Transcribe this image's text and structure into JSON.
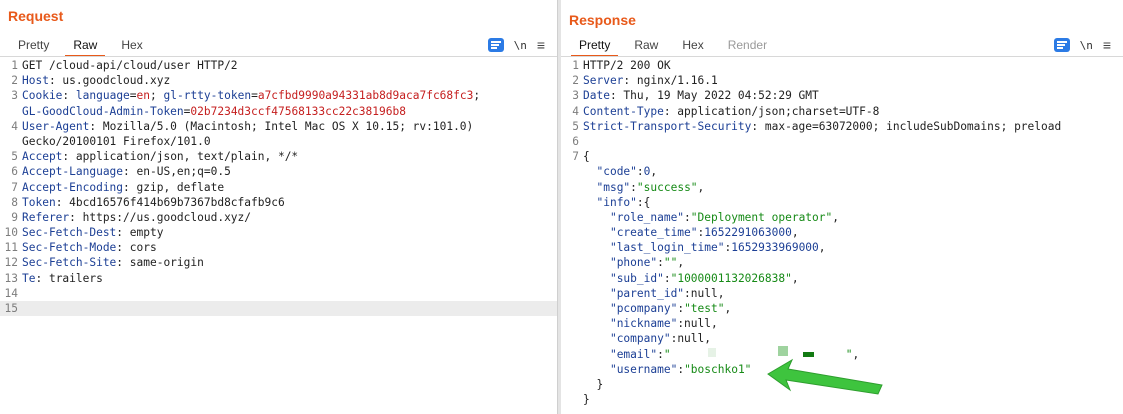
{
  "request": {
    "title": "Request",
    "tabs": [
      "Pretty",
      "Raw",
      "Hex"
    ],
    "active_tab": "Raw",
    "lines": [
      [
        {
          "t": "GET /cloud-api/cloud/user HTTP/2",
          "c": "plain"
        }
      ],
      [
        {
          "t": "Host",
          "c": "hname"
        },
        {
          "t": ": us.goodcloud.xyz",
          "c": "hval"
        }
      ],
      [
        {
          "t": "Cookie",
          "c": "hname"
        },
        {
          "t": ": ",
          "c": "hval"
        },
        {
          "t": "language",
          "c": "hname"
        },
        {
          "t": "=",
          "c": "hval"
        },
        {
          "t": "en",
          "c": "ck"
        },
        {
          "t": "; ",
          "c": "hval"
        },
        {
          "t": "gl-rtty-token",
          "c": "hname"
        },
        {
          "t": "=",
          "c": "hval"
        },
        {
          "t": "a7cfbd9990a94331ab8d9aca7fc68fc3",
          "c": "ck"
        },
        {
          "t": ";",
          "c": "hval"
        }
      ],
      [
        {
          "t": "GL-GoodCloud-Admin-Token",
          "c": "hname"
        },
        {
          "t": "=",
          "c": "hval"
        },
        {
          "t": "02b7234d3ccf47568133cc22c38196b8",
          "c": "ck"
        }
      ],
      [
        {
          "t": "User-Agent",
          "c": "hname"
        },
        {
          "t": ": Mozilla/5.0 (Macintosh; Intel Mac OS X 10.15; rv:101.0)",
          "c": "hval"
        }
      ],
      [
        {
          "t": "Gecko/20100101 Firefox/101.0",
          "c": "hval"
        }
      ],
      [
        {
          "t": "Accept",
          "c": "hname"
        },
        {
          "t": ": application/json, text/plain, */*",
          "c": "hval"
        }
      ],
      [
        {
          "t": "Accept-Language",
          "c": "hname"
        },
        {
          "t": ": en-US,en;q=0.5",
          "c": "hval"
        }
      ],
      [
        {
          "t": "Accept-Encoding",
          "c": "hname"
        },
        {
          "t": ": gzip, deflate",
          "c": "hval"
        }
      ],
      [
        {
          "t": "Token",
          "c": "hname"
        },
        {
          "t": ": 4bcd16576f414b69b7367bd8cfafb9c6",
          "c": "hval"
        }
      ],
      [
        {
          "t": "Referer",
          "c": "hname"
        },
        {
          "t": ": https://us.goodcloud.xyz/",
          "c": "hval"
        }
      ],
      [
        {
          "t": "Sec-Fetch-Dest",
          "c": "hname"
        },
        {
          "t": ": empty",
          "c": "hval"
        }
      ],
      [
        {
          "t": "Sec-Fetch-Mode",
          "c": "hname"
        },
        {
          "t": ": cors",
          "c": "hval"
        }
      ],
      [
        {
          "t": "Sec-Fetch-Site",
          "c": "hname"
        },
        {
          "t": ": same-origin",
          "c": "hval"
        }
      ],
      [
        {
          "t": "Te",
          "c": "hname"
        },
        {
          "t": ": trailers",
          "c": "hval"
        }
      ],
      [],
      []
    ],
    "line_numbers": [
      "1",
      "2",
      "3",
      "",
      "4",
      "",
      "5",
      "6",
      "7",
      "8",
      "9",
      "10",
      "11",
      "12",
      "13",
      "14",
      "15"
    ]
  },
  "response": {
    "title": "Response",
    "tabs": [
      "Pretty",
      "Raw",
      "Hex",
      "Render"
    ],
    "active_tab": "Pretty",
    "lines": [
      [
        {
          "t": "HTTP/2 200 OK",
          "c": "plain"
        }
      ],
      [
        {
          "t": "Server",
          "c": "hname"
        },
        {
          "t": ": nginx/1.16.1",
          "c": "hval"
        }
      ],
      [
        {
          "t": "Date",
          "c": "hname"
        },
        {
          "t": ": Thu, 19 May 2022 04:52:29 GMT",
          "c": "hval"
        }
      ],
      [
        {
          "t": "Content-Type",
          "c": "hname"
        },
        {
          "t": ": application/json;charset=UTF-8",
          "c": "hval"
        }
      ],
      [
        {
          "t": "Strict-Transport-Security",
          "c": "hname"
        },
        {
          "t": ": max-age=63072000; includeSubDomains; preload",
          "c": "hval"
        }
      ],
      [],
      [
        {
          "t": "{",
          "c": "plain"
        }
      ],
      [
        {
          "t": "  ",
          "c": "plain"
        },
        {
          "t": "\"code\"",
          "c": "jkey"
        },
        {
          "t": ":",
          "c": "plain"
        },
        {
          "t": "0",
          "c": "jnum"
        },
        {
          "t": ",",
          "c": "plain"
        }
      ],
      [
        {
          "t": "  ",
          "c": "plain"
        },
        {
          "t": "\"msg\"",
          "c": "jkey"
        },
        {
          "t": ":",
          "c": "plain"
        },
        {
          "t": "\"success\"",
          "c": "jstr"
        },
        {
          "t": ",",
          "c": "plain"
        }
      ],
      [
        {
          "t": "  ",
          "c": "plain"
        },
        {
          "t": "\"info\"",
          "c": "jkey"
        },
        {
          "t": ":{",
          "c": "plain"
        }
      ],
      [
        {
          "t": "    ",
          "c": "plain"
        },
        {
          "t": "\"role_name\"",
          "c": "jkey"
        },
        {
          "t": ":",
          "c": "plain"
        },
        {
          "t": "\"Deployment operator\"",
          "c": "jstr"
        },
        {
          "t": ",",
          "c": "plain"
        }
      ],
      [
        {
          "t": "    ",
          "c": "plain"
        },
        {
          "t": "\"create_time\"",
          "c": "jkey"
        },
        {
          "t": ":",
          "c": "plain"
        },
        {
          "t": "1652291063000",
          "c": "jnum"
        },
        {
          "t": ",",
          "c": "plain"
        }
      ],
      [
        {
          "t": "    ",
          "c": "plain"
        },
        {
          "t": "\"last_login_time\"",
          "c": "jkey"
        },
        {
          "t": ":",
          "c": "plain"
        },
        {
          "t": "1652933969000",
          "c": "jnum"
        },
        {
          "t": ",",
          "c": "plain"
        }
      ],
      [
        {
          "t": "    ",
          "c": "plain"
        },
        {
          "t": "\"phone\"",
          "c": "jkey"
        },
        {
          "t": ":",
          "c": "plain"
        },
        {
          "t": "\"\"",
          "c": "jstr"
        },
        {
          "t": ",",
          "c": "plain"
        }
      ],
      [
        {
          "t": "    ",
          "c": "plain"
        },
        {
          "t": "\"sub_id\"",
          "c": "jkey"
        },
        {
          "t": ":",
          "c": "plain"
        },
        {
          "t": "\"1000001132026838\"",
          "c": "jstr"
        },
        {
          "t": ",",
          "c": "plain"
        }
      ],
      [
        {
          "t": "    ",
          "c": "plain"
        },
        {
          "t": "\"parent_id\"",
          "c": "jkey"
        },
        {
          "t": ":null,",
          "c": "plain"
        }
      ],
      [
        {
          "t": "    ",
          "c": "plain"
        },
        {
          "t": "\"pcompany\"",
          "c": "jkey"
        },
        {
          "t": ":",
          "c": "plain"
        },
        {
          "t": "\"test\"",
          "c": "jstr"
        },
        {
          "t": ",",
          "c": "plain"
        }
      ],
      [
        {
          "t": "    ",
          "c": "plain"
        },
        {
          "t": "\"nickname\"",
          "c": "jkey"
        },
        {
          "t": ":null,",
          "c": "plain"
        }
      ],
      [
        {
          "t": "    ",
          "c": "plain"
        },
        {
          "t": "\"company\"",
          "c": "jkey"
        },
        {
          "t": ":null,",
          "c": "plain"
        }
      ],
      [
        {
          "t": "    ",
          "c": "plain"
        },
        {
          "t": "\"email\"",
          "c": "jkey"
        },
        {
          "t": ":",
          "c": "plain"
        },
        {
          "t": "\"                          \"",
          "c": "jstr"
        },
        {
          "t": ",",
          "c": "plain"
        }
      ],
      [
        {
          "t": "    ",
          "c": "plain"
        },
        {
          "t": "\"username\"",
          "c": "jkey"
        },
        {
          "t": ":",
          "c": "plain"
        },
        {
          "t": "\"boschko1\"",
          "c": "jstr"
        }
      ],
      [
        {
          "t": "  }",
          "c": "plain"
        }
      ],
      [
        {
          "t": "}",
          "c": "plain"
        }
      ]
    ],
    "line_numbers": [
      "1",
      "2",
      "3",
      "4",
      "5",
      "6",
      "7",
      "",
      "",
      "",
      "",
      "",
      "",
      "",
      "",
      "",
      "",
      "",
      "",
      "",
      "",
      "",
      ""
    ]
  },
  "toolbar": {
    "newline_label": "\\n",
    "menu_label": "≡"
  },
  "colors": {
    "accent": "#e8591a",
    "header_name": "#1c3f95",
    "cookie_value": "#c51f1f",
    "json_string": "#168a16",
    "highlight_arrow": "#3ec43e"
  }
}
